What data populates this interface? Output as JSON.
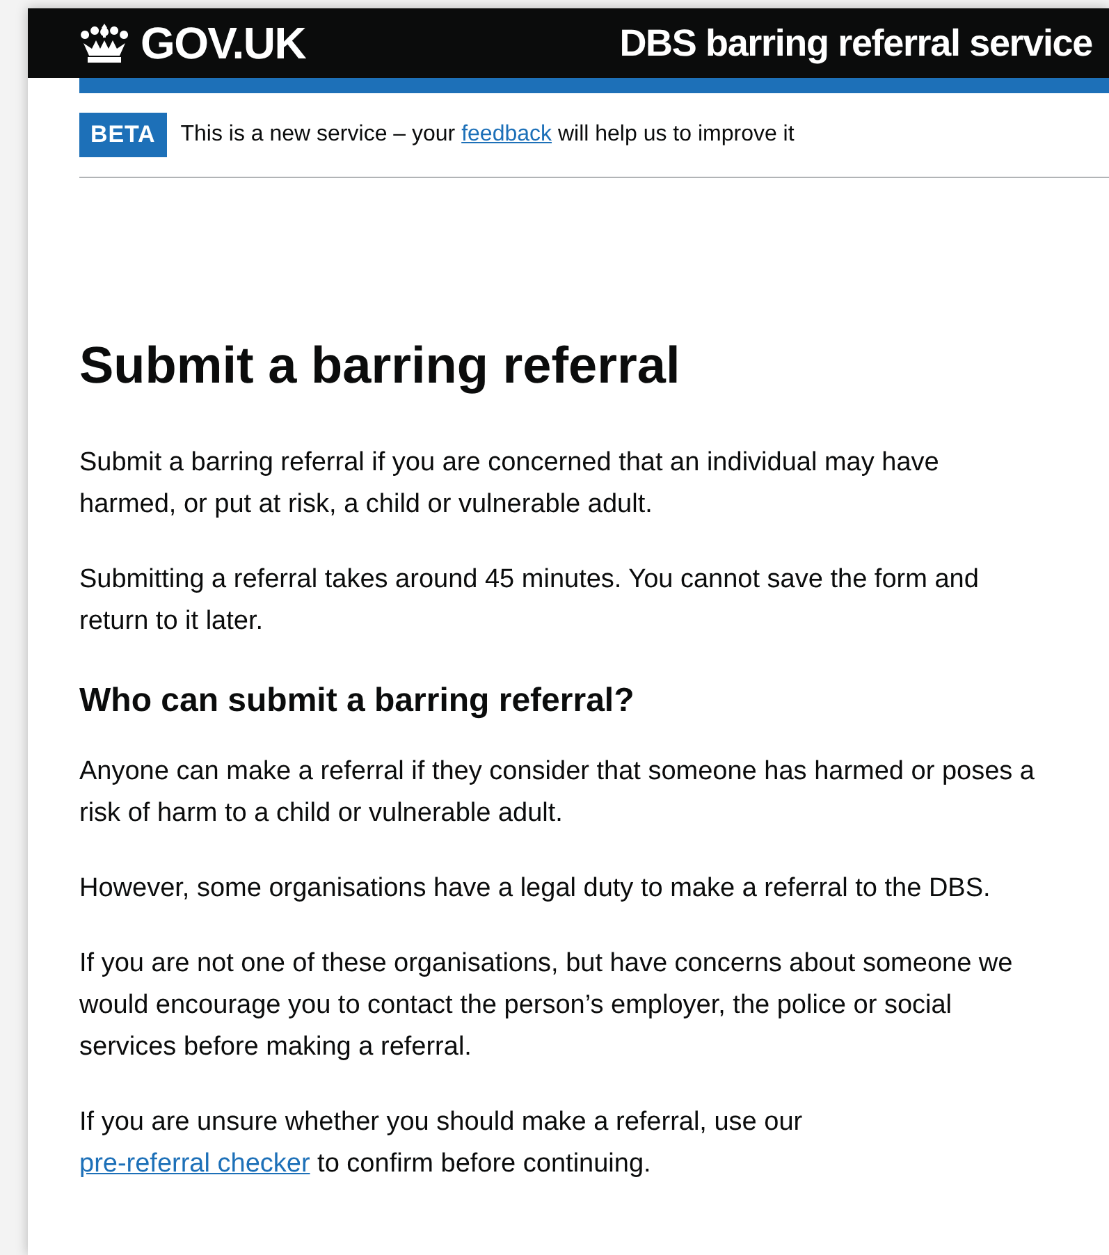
{
  "header": {
    "logo_text": "GOV.UK",
    "service_name": "DBS barring referral service"
  },
  "phase_banner": {
    "tag": "BETA",
    "parts": [
      {
        "kind": "text",
        "text": "This is a new service – your "
      },
      {
        "kind": "link",
        "text": "feedback"
      },
      {
        "kind": "text",
        "text": " will help us to improve it"
      }
    ]
  },
  "title": "Submit a barring referral",
  "blocks": [
    {
      "kind": "paragraph",
      "parts": [
        {
          "kind": "text",
          "text": "Submit a barring referral if you are concerned that an individual may have harmed, or put at risk, a child or vulnerable adult."
        }
      ]
    },
    {
      "kind": "paragraph",
      "parts": [
        {
          "kind": "text",
          "text": "Submitting a referral takes around 45 minutes. You cannot save the form and return to it later."
        }
      ]
    },
    {
      "kind": "heading",
      "text": "Who can submit a barring referral?"
    },
    {
      "kind": "paragraph",
      "parts": [
        {
          "kind": "text",
          "text": "Anyone can make a referral if they consider that someone has harmed or poses a risk of harm to a child or vulnerable adult."
        }
      ]
    },
    {
      "kind": "paragraph",
      "parts": [
        {
          "kind": "text",
          "text": "However, some organisations have a legal duty to make a referral to the DBS."
        }
      ]
    },
    {
      "kind": "paragraph",
      "parts": [
        {
          "kind": "text",
          "text": "If you are not one of these organisations, but have concerns about someone we would encourage you to contact the person’s employer, the police or social services before making a referral."
        }
      ]
    },
    {
      "kind": "paragraph",
      "parts": [
        {
          "kind": "text",
          "text": "If you are unsure whether you should make a referral, use our "
        },
        {
          "kind": "link",
          "text": "pre-referral checker"
        },
        {
          "kind": "text",
          "text": " to confirm before continuing."
        }
      ]
    }
  ]
}
